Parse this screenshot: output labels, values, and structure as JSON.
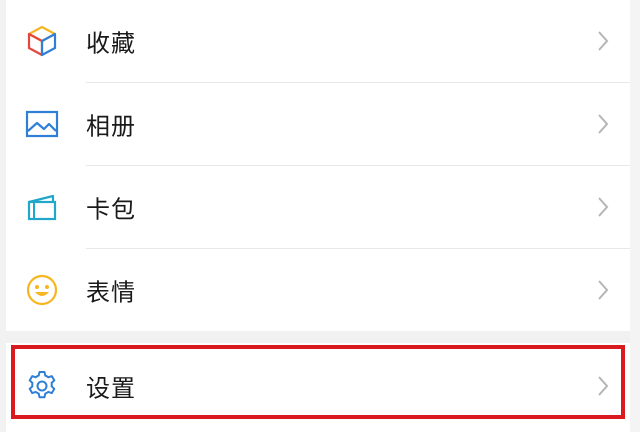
{
  "menu": {
    "items": [
      {
        "label": "收藏",
        "icon": "favorites-cube-icon"
      },
      {
        "label": "相册",
        "icon": "photo-album-icon"
      },
      {
        "label": "卡包",
        "icon": "card-wallet-icon"
      },
      {
        "label": "表情",
        "icon": "smiley-emoji-icon"
      }
    ],
    "settings": {
      "label": "设置",
      "icon": "gear-icon"
    }
  },
  "colors": {
    "highlight_border": "#d91a1f",
    "icon_blue": "#2f7fd6",
    "icon_yellow": "#f5b621",
    "icon_red": "#e5463b",
    "icon_teal": "#20a7c9"
  }
}
